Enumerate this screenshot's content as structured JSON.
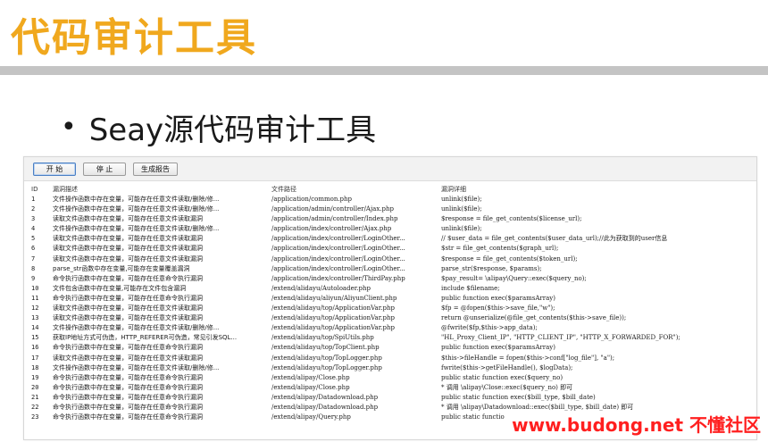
{
  "slide": {
    "title": "代码审计工具",
    "bullet": "Seay源代码审计工具"
  },
  "toolbar": {
    "start_label": "开 始",
    "stop_label": "停 止",
    "report_label": "生成报告"
  },
  "table": {
    "columns": [
      "ID",
      "漏洞描述",
      "文件路径",
      "漏洞详细"
    ],
    "rows": [
      [
        "1",
        "文件操作函数中存在变量，可能存在任意文件读取/删除/修...",
        "/application/common.php",
        "unlink($file);"
      ],
      [
        "2",
        "文件操作函数中存在变量，可能存在任意文件读取/删除/修...",
        "/application/admin/controller/Ajax.php",
        "unlink($file);"
      ],
      [
        "3",
        "读取文件函数中存在变量，可能存在任意文件读取漏洞",
        "/application/admin/controller/Index.php",
        "$response = file_get_contents($license_url);"
      ],
      [
        "4",
        "文件操作函数中存在变量，可能存在任意文件读取/删除/修...",
        "/application/index/controller/Ajax.php",
        "unlink($file);"
      ],
      [
        "5",
        "读取文件函数中存在变量，可能存在任意文件读取漏洞",
        "/application/index/controller/LoginOther...",
        "//    $user_data = file_get_contents($user_data_url);//此为获取到的user信息"
      ],
      [
        "6",
        "读取文件函数中存在变量，可能存在任意文件读取漏洞",
        "/application/index/controller/LoginOther...",
        "$str = file_get_contents($graph_url);"
      ],
      [
        "7",
        "读取文件函数中存在变量，可能存在任意文件读取漏洞",
        "/application/index/controller/LoginOther...",
        "$response = file_get_contents($token_url);"
      ],
      [
        "8",
        "parse_str函数中存在变量,可能存在变量覆盖漏洞",
        "/application/index/controller/LoginOther...",
        "parse_str($response, $params);"
      ],
      [
        "9",
        "命令执行函数中存在变量，可能存在任意命令执行漏洞",
        "/application/index/controller/ThirdPay.php",
        "$pay_result= \\alipay\\Query::exec($query_no);"
      ],
      [
        "10",
        "文件包含函数中存在变量,可能存在文件包含漏洞",
        "/extend/alidayu/Autoloader.php",
        "include $filename;"
      ],
      [
        "11",
        "命令执行函数中存在变量，可能存在任意命令执行漏洞",
        "/extend/alidayu/aliyun/AliyunClient.php",
        "public function exec($paramsArray)"
      ],
      [
        "12",
        "读取文件函数中存在变量，可能存在任意文件读取漏洞",
        "/extend/alidayu/top/ApplicationVar.php",
        "$fp = @fopen($this->save_file,\"w\");"
      ],
      [
        "13",
        "读取文件函数中存在变量，可能存在任意文件读取漏洞",
        "/extend/alidayu/top/ApplicationVar.php",
        "return @unserialize(@file_get_contents($this->save_file));"
      ],
      [
        "14",
        "文件操作函数中存在变量，可能存在任意文件读取/删除/修...",
        "/extend/alidayu/top/ApplicationVar.php",
        "@fwrite($fp,$this->app_data);"
      ],
      [
        "15",
        "获取IP地址方式可伪造，HTTP_REFERER可伪造，常见引发SQL...",
        "/extend/alidayu/top/SpiUtils.php",
        "\"HL_Proxy_Client_IP\", \"HTTP_CLIENT_IP\", \"HTTP_X_FORWARDED_FOR\");"
      ],
      [
        "16",
        "命令执行函数中存在变量，可能存在任意命令执行漏洞",
        "/extend/alidayu/top/TopClient.php",
        "public function exec($paramsArray)"
      ],
      [
        "17",
        "读取文件函数中存在变量，可能存在任意文件读取漏洞",
        "/extend/alidayu/top/TopLogger.php",
        "$this->fileHandle = fopen($this->conf[\"log_file\"], \"a\");"
      ],
      [
        "18",
        "文件操作函数中存在变量，可能存在任意文件读取/删除/修...",
        "/extend/alidayu/top/TopLogger.php",
        "fwrite($this->getFileHandle(), $logData);"
      ],
      [
        "19",
        "命令执行函数中存在变量，可能存在任意命令执行漏洞",
        "/extend/alipay/Close.php",
        "public static function exec($query_no)"
      ],
      [
        "20",
        "命令执行函数中存在变量，可能存在任意命令执行漏洞",
        "/extend/alipay/Close.php",
        "* 调用 \\alipay\\Close::exec($query_no) 即可"
      ],
      [
        "21",
        "命令执行函数中存在变量，可能存在任意命令执行漏洞",
        "/extend/alipay/Datadownload.php",
        "public static function exec($bill_type, $bill_date)"
      ],
      [
        "22",
        "命令执行函数中存在变量，可能存在任意命令执行漏洞",
        "/extend/alipay/Datadownload.php",
        "* 调用 \\alipay\\Datadownload::exec($bill_type, $bill_date) 即可"
      ],
      [
        "23",
        "命令执行函数中存在变量，可能存在任意命令执行漏洞",
        "/extend/alipay/Query.php",
        "public static functio"
      ]
    ]
  },
  "watermark": "www.budong.net 不懂社区",
  "colors": {
    "title": "#f0a81e",
    "watermark": "#ff1f1f"
  }
}
